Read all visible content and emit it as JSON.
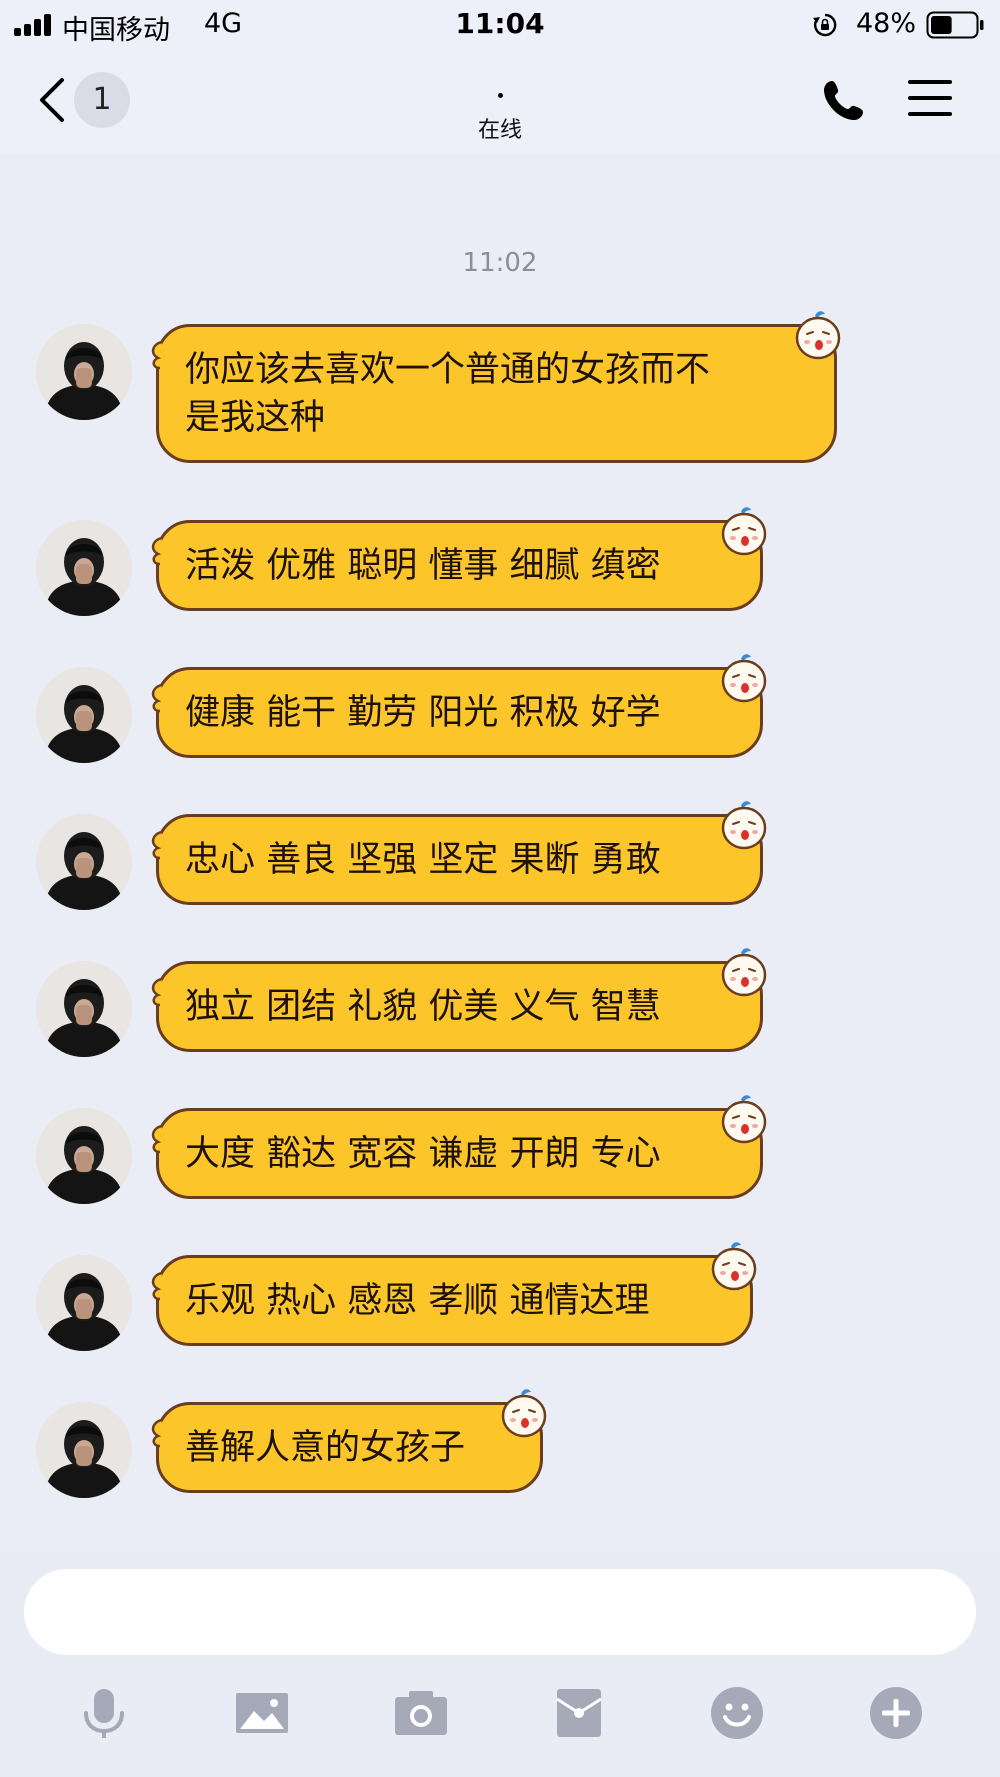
{
  "status_bar": {
    "carrier": "中国移动",
    "network": "4G",
    "time": "11:04",
    "battery": "48%",
    "battery_level": 0.48
  },
  "nav": {
    "back_count": "1",
    "title": "·",
    "status": "在线"
  },
  "chat": {
    "timestamp": "11:02",
    "messages": [
      {
        "text": "你应该去喜欢一个普通的女孩而不\n是我这种"
      },
      {
        "text": "活泼 优雅 聪明 懂事 细腻 缜密"
      },
      {
        "text": "健康 能干 勤劳 阳光 积极 好学"
      },
      {
        "text": "忠心 善良 坚强 坚定 果断 勇敢"
      },
      {
        "text": "独立 团结 礼貌 优美 义气 智慧"
      },
      {
        "text": "大度 豁达 宽容 谦虚 开朗 专心"
      },
      {
        "text": "乐观 热心 感恩 孝顺 通情达理"
      },
      {
        "text": "善解人意的女孩子"
      }
    ]
  },
  "input": {
    "placeholder": ""
  },
  "toolbar": {
    "icons": [
      "microphone-icon",
      "image-icon",
      "camera-icon",
      "red-packet-icon",
      "emoji-icon",
      "plus-icon"
    ]
  },
  "colors": {
    "bubble": "#fcc62b",
    "bubble_border": "#6a3d1f",
    "background": "#ebedf6",
    "icon_gray": "#a6a9b7"
  }
}
